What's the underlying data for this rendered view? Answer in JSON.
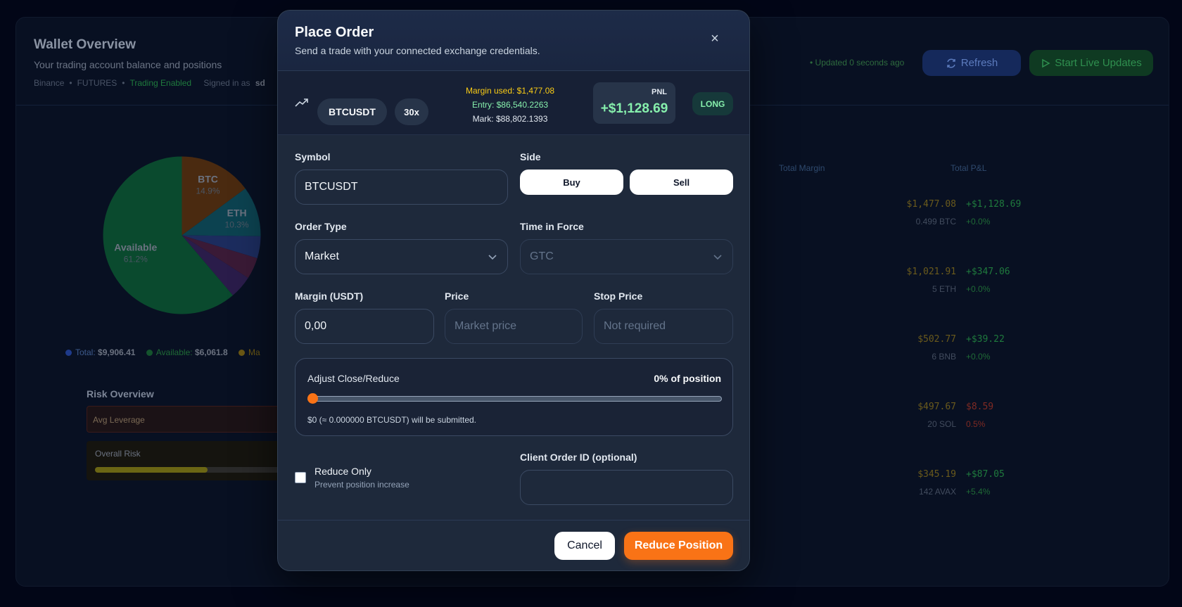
{
  "background": {
    "title": "Wallet Overview",
    "subtitle": "Your trading account balance and positions",
    "meta": {
      "exchange": "Binance",
      "market": "FUTURES",
      "trading": "Trading Enabled",
      "signed_in": "Signed in as",
      "user": "sd"
    },
    "updated": "• Updated 0 seconds ago",
    "refresh_label": "Refresh",
    "live_label": "Start Live Updates",
    "pie": {
      "slices": [
        {
          "label": "BTC",
          "pct": "14.9%",
          "value": 14.9,
          "color": "#4a2a10"
        },
        {
          "label": "ETH",
          "pct": "10.3%",
          "value": 10.3,
          "color": "#0c4250"
        },
        {
          "label": "",
          "pct": "",
          "value": 4.5,
          "color": "#1c2c5e"
        },
        {
          "label": "",
          "pct": "",
          "value": 4.4,
          "color": "#3a1a36"
        },
        {
          "label": "",
          "pct": "",
          "value": 4.7,
          "color": "#2a1c4a"
        },
        {
          "label": "Available",
          "pct": "61.2%",
          "value": 61.2,
          "color": "#0a4a2e"
        }
      ]
    },
    "legend": {
      "total_label": "Total:",
      "total_value": "$9,906.41",
      "available_label": "Available:",
      "available_value": "$6,061.8",
      "margin_label": "Ma"
    },
    "risk": {
      "title": "Risk Overview",
      "avg_leverage": "Avg Leverage",
      "overall_risk": "Overall Risk",
      "overall_level": 0.57
    },
    "table": {
      "headers": [
        "Total Margin",
        "Total P&L"
      ],
      "rows": [
        {
          "margin": "$1,477.08",
          "qty": "0.499 BTC",
          "pnl": "+$1,128.69",
          "pct": "+0.0%",
          "neg": false
        },
        {
          "margin": "$1,021.91",
          "qty": "5 ETH",
          "pnl": "+$347.06",
          "pct": "+0.0%",
          "neg": false
        },
        {
          "margin": "$502.77",
          "qty": "6 BNB",
          "pnl": "+$39.22",
          "pct": "+0.0%",
          "neg": false
        },
        {
          "margin": "$497.67",
          "qty": "20 SOL",
          "pnl": "$8.59",
          "pct": "0.5%",
          "neg": true
        },
        {
          "margin": "$345.19",
          "qty": "142 AVAX",
          "pnl": "+$87.05",
          "pct": "+5.4%",
          "neg": false
        }
      ]
    }
  },
  "modal": {
    "title": "Place Order",
    "description": "Send a trade with your connected exchange credentials.",
    "close_icon": "×",
    "position": {
      "symbol": "BTCUSDT",
      "leverage": "30x",
      "margin_used": "Margin used: $1,477.08",
      "entry": "Entry: $86,540.2263",
      "mark": "Mark: $88,802.1393",
      "pnl_label": "PNL",
      "pnl_value": "+$1,128.69",
      "side_badge": "LONG"
    },
    "form": {
      "symbol_label": "Symbol",
      "symbol_value": "BTCUSDT",
      "side_label": "Side",
      "buy_label": "Buy",
      "sell_label": "Sell",
      "order_type_label": "Order Type",
      "order_type_value": "Market",
      "tif_label": "Time in Force",
      "tif_value": "GTC",
      "margin_label": "Margin (USDT)",
      "margin_value": "0,00",
      "price_label": "Price",
      "price_placeholder": "Market price",
      "stop_label": "Stop Price",
      "stop_placeholder": "Not required",
      "adjust_title": "Adjust Close/Reduce",
      "adjust_pct": "0% of position",
      "adjust_level": 0,
      "adjust_note": "$0 (≈ 0.000000 BTCUSDT) will be submitted.",
      "reduce_only_title": "Reduce Only",
      "reduce_only_sub": "Prevent position increase",
      "client_id_label": "Client Order ID (optional)",
      "client_id_value": ""
    },
    "footer": {
      "cancel_label": "Cancel",
      "reduce_label": "Reduce Position"
    }
  },
  "colors": {
    "accent": "#f97316",
    "pnl_positive": "#86efac",
    "margin_yellow": "#facc15"
  }
}
